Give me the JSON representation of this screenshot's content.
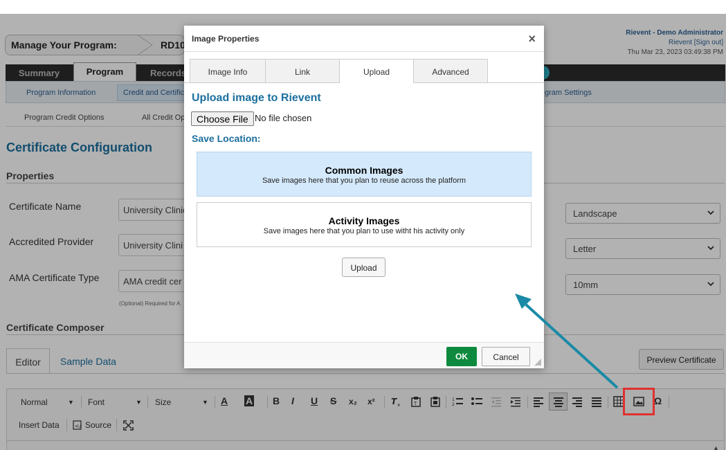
{
  "breadcrumb": {
    "label": "Manage Your Program:",
    "program": "RD10"
  },
  "user": {
    "name": "Rievent - Demo Administrator",
    "org": "Rievent",
    "signout": "[Sign out]",
    "datetime": "Thu Mar 23, 2023 03:49:38 PM"
  },
  "main_tabs": [
    "Summary",
    "Program",
    "Records"
  ],
  "subnav": {
    "items": [
      "Program Information",
      "Credit and Certifica",
      "gram Settings"
    ]
  },
  "subsub": {
    "items": [
      "Program Credit Options",
      "All Credit Op"
    ]
  },
  "page": {
    "title": "Certificate Configuration",
    "properties_heading": "Properties",
    "composer_heading": "Certificate Composer"
  },
  "form": {
    "certificate_name": {
      "label": "Certificate Name",
      "value": "University Clinic"
    },
    "accredited_provider": {
      "label": "Accredited Provider",
      "value": "University Clini"
    },
    "ama_type": {
      "label": "AMA Certificate Type",
      "value": "AMA credit cer",
      "hint": "(Optional) Required for A"
    },
    "orientation": "Landscape",
    "paper_size": "Letter",
    "margin": "10mm"
  },
  "editor": {
    "tab_editor": "Editor",
    "tab_sample": "Sample Data",
    "preview_button": "Preview Certificate"
  },
  "toolbar": {
    "format": "Normal",
    "font": "Font",
    "size": "Size",
    "text_color": "A",
    "bg_color": "A",
    "bold": "B",
    "italic": "I",
    "underline": "U",
    "strike": "S",
    "subscript": "x₂",
    "superscript": "x²",
    "insert_data": "Insert Data",
    "source": "Source",
    "omega": "Ω"
  },
  "modal": {
    "title": "Image Properties",
    "close": "×",
    "tabs": [
      "Image Info",
      "Link",
      "Upload",
      "Advanced"
    ],
    "heading": "Upload image to Rievent",
    "choose_file": "Choose File",
    "no_file": "No file chosen",
    "save_location": "Save Location:",
    "locations": [
      {
        "title": "Common Images",
        "desc": "Save images here that you plan to reuse across the platform"
      },
      {
        "title": "Activity Images",
        "desc": "Save images here that you plan to use witht his activity only"
      }
    ],
    "upload_button": "Upload",
    "ok": "OK",
    "cancel": "Cancel"
  },
  "colors": {
    "accent": "#1b6f9e",
    "ok_green": "#0e8a3e",
    "highlight_red": "#e0312f",
    "arrow_teal": "#1a8aa6"
  }
}
